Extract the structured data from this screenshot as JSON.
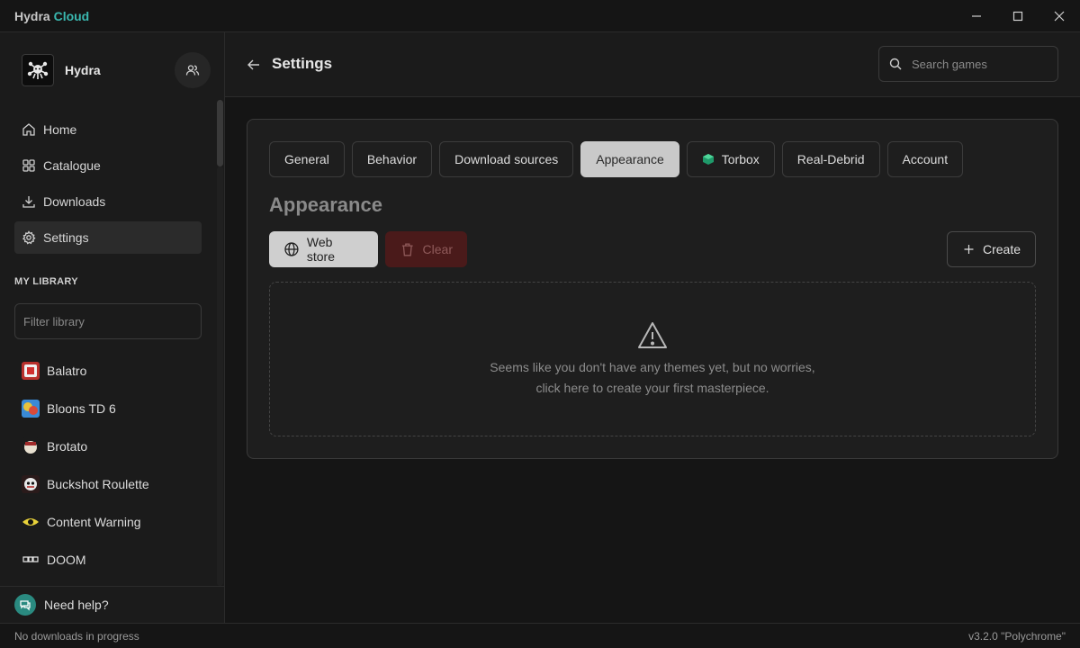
{
  "window": {
    "title_primary": "Hydra",
    "title_accent": "Cloud",
    "accent_color": "#3ab8b0"
  },
  "sidebar": {
    "profile_name": "Hydra",
    "nav": [
      {
        "label": "Home",
        "icon": "home-icon"
      },
      {
        "label": "Catalogue",
        "icon": "grid-icon"
      },
      {
        "label": "Downloads",
        "icon": "download-icon"
      },
      {
        "label": "Settings",
        "icon": "gear-icon",
        "active": true
      }
    ],
    "library_label": "MY LIBRARY",
    "filter_placeholder": "Filter library",
    "library": [
      {
        "name": "Balatro"
      },
      {
        "name": "Bloons TD 6"
      },
      {
        "name": "Brotato"
      },
      {
        "name": "Buckshot Roulette"
      },
      {
        "name": "Content Warning"
      },
      {
        "name": "DOOM"
      }
    ],
    "help_label": "Need help?"
  },
  "header": {
    "title": "Settings",
    "search_placeholder": "Search games"
  },
  "settings": {
    "tabs": [
      {
        "label": "General"
      },
      {
        "label": "Behavior"
      },
      {
        "label": "Download sources"
      },
      {
        "label": "Appearance",
        "active": true
      },
      {
        "label": "Torbox"
      },
      {
        "label": "Real-Debrid"
      },
      {
        "label": "Account"
      }
    ],
    "section_title": "Appearance",
    "web_store_label": "Web store",
    "clear_label": "Clear",
    "create_label": "Create",
    "empty_line1": "Seems like you don't have any themes yet, but no worries,",
    "empty_line2": "click here to create your first masterpiece."
  },
  "statusbar": {
    "left": "No downloads in progress",
    "right": "v3.2.0 \"Polychrome\""
  }
}
